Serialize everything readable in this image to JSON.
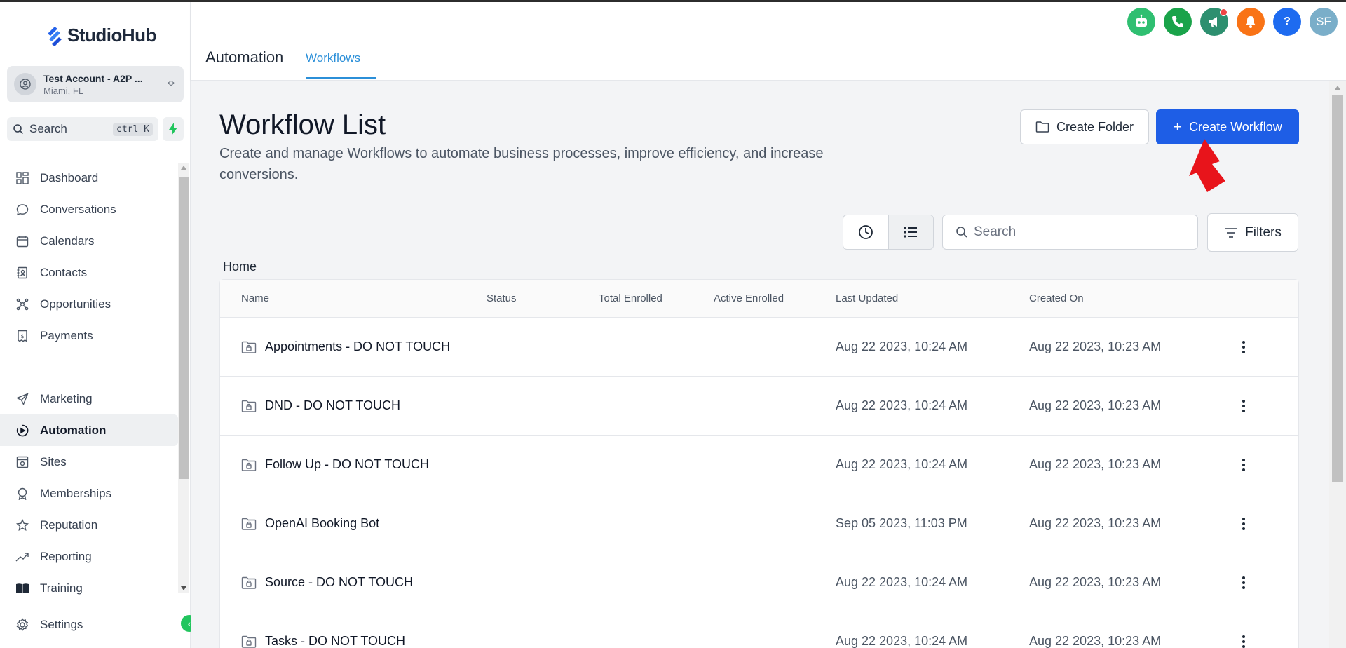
{
  "brand": {
    "name": "StudioHub"
  },
  "account": {
    "name": "Test Account - A2P ...",
    "location": "Miami, FL"
  },
  "sidebar_search": {
    "label": "Search",
    "shortcut": "ctrl K"
  },
  "nav": {
    "items": [
      {
        "label": "Dashboard"
      },
      {
        "label": "Conversations"
      },
      {
        "label": "Calendars"
      },
      {
        "label": "Contacts"
      },
      {
        "label": "Opportunities"
      },
      {
        "label": "Payments"
      },
      {
        "label": "Marketing"
      },
      {
        "label": "Automation"
      },
      {
        "label": "Sites"
      },
      {
        "label": "Memberships"
      },
      {
        "label": "Reputation"
      },
      {
        "label": "Reporting"
      },
      {
        "label": "Training"
      }
    ],
    "settings": "Settings",
    "active": "Automation"
  },
  "header": {
    "title": "Automation",
    "tab": "Workflows",
    "avatar_initials": "SF",
    "help": "?"
  },
  "page": {
    "title": "Workflow List",
    "description": "Create and manage Workflows to automate business processes, improve efficiency, and increase conversions.",
    "create_folder": "Create Folder",
    "create_workflow": "Create Workflow",
    "search_placeholder": "Search",
    "filters": "Filters",
    "breadcrumb": "Home"
  },
  "table": {
    "columns": [
      "Name",
      "Status",
      "Total Enrolled",
      "Active Enrolled",
      "Last Updated",
      "Created On"
    ],
    "rows": [
      {
        "name": "Appointments - DO NOT TOUCH",
        "updated": "Aug 22 2023, 10:24 AM",
        "created": "Aug 22 2023, 10:23 AM"
      },
      {
        "name": "DND - DO NOT TOUCH",
        "updated": "Aug 22 2023, 10:24 AM",
        "created": "Aug 22 2023, 10:23 AM"
      },
      {
        "name": "Follow Up - DO NOT TOUCH",
        "updated": "Aug 22 2023, 10:24 AM",
        "created": "Aug 22 2023, 10:23 AM"
      },
      {
        "name": "OpenAI Booking Bot",
        "updated": "Sep 05 2023, 11:03 PM",
        "created": "Aug 22 2023, 10:23 AM"
      },
      {
        "name": "Source - DO NOT TOUCH",
        "updated": "Aug 22 2023, 10:24 AM",
        "created": "Aug 22 2023, 10:23 AM"
      },
      {
        "name": "Tasks - DO NOT TOUCH",
        "updated": "Aug 22 2023, 10:24 AM",
        "created": "Aug 22 2023, 10:23 AM"
      }
    ]
  },
  "colors": {
    "primary": "#1e5ee6",
    "tab_accent": "#2b8fd8",
    "annotation_arrow": "#e8141b",
    "icon_bot": "#2fbf71",
    "icon_phone": "#1aa34a",
    "icon_megaphone": "#2d8f6f",
    "icon_bell": "#f97316",
    "icon_help": "#1e6bf0",
    "icon_avatar": "#7aaec9"
  }
}
